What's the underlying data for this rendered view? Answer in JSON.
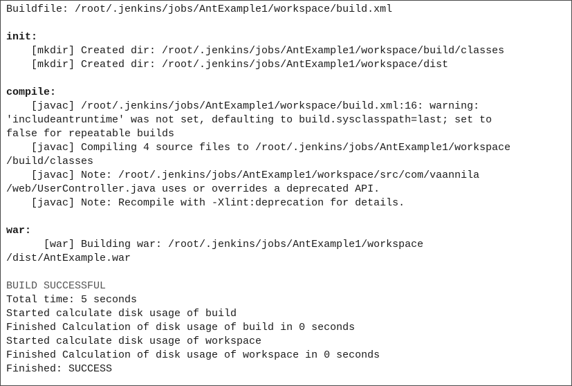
{
  "console": {
    "lines": [
      {
        "text": "Buildfile: /root/.jenkins/jobs/AntExample1/workspace/build.xml",
        "kind": "normal"
      },
      {
        "text": "",
        "kind": "blank"
      },
      {
        "text": "init:",
        "kind": "target"
      },
      {
        "text": "    [mkdir] Created dir: /root/.jenkins/jobs/AntExample1/workspace/build/classes",
        "kind": "normal"
      },
      {
        "text": "    [mkdir] Created dir: /root/.jenkins/jobs/AntExample1/workspace/dist",
        "kind": "normal"
      },
      {
        "text": "",
        "kind": "blank"
      },
      {
        "text": "compile:",
        "kind": "target"
      },
      {
        "text": "    [javac] /root/.jenkins/jobs/AntExample1/workspace/build.xml:16: warning:",
        "kind": "normal"
      },
      {
        "text": "'includeantruntime' was not set, defaulting to build.sysclasspath=last; set to",
        "kind": "normal"
      },
      {
        "text": "false for repeatable builds",
        "kind": "normal"
      },
      {
        "text": "    [javac] Compiling 4 source files to /root/.jenkins/jobs/AntExample1/workspace",
        "kind": "normal"
      },
      {
        "text": "/build/classes",
        "kind": "normal"
      },
      {
        "text": "    [javac] Note: /root/.jenkins/jobs/AntExample1/workspace/src/com/vaannila",
        "kind": "normal"
      },
      {
        "text": "/web/UserController.java uses or overrides a deprecated API.",
        "kind": "normal"
      },
      {
        "text": "    [javac] Note: Recompile with -Xlint:deprecation for details.",
        "kind": "normal"
      },
      {
        "text": "",
        "kind": "blank"
      },
      {
        "text": "war:",
        "kind": "target"
      },
      {
        "text": "      [war] Building war: /root/.jenkins/jobs/AntExample1/workspace",
        "kind": "normal"
      },
      {
        "text": "/dist/AntExample.war",
        "kind": "normal"
      },
      {
        "text": "",
        "kind": "blank"
      },
      {
        "text": "BUILD SUCCESSFUL",
        "kind": "status"
      },
      {
        "text": "Total time: 5 seconds",
        "kind": "normal"
      },
      {
        "text": "Started calculate disk usage of build",
        "kind": "normal"
      },
      {
        "text": "Finished Calculation of disk usage of build in 0 seconds",
        "kind": "normal"
      },
      {
        "text": "Started calculate disk usage of workspace",
        "kind": "normal"
      },
      {
        "text": "Finished Calculation of disk usage of workspace in 0 seconds",
        "kind": "normal"
      },
      {
        "text": "Finished: SUCCESS",
        "kind": "normal"
      }
    ]
  }
}
